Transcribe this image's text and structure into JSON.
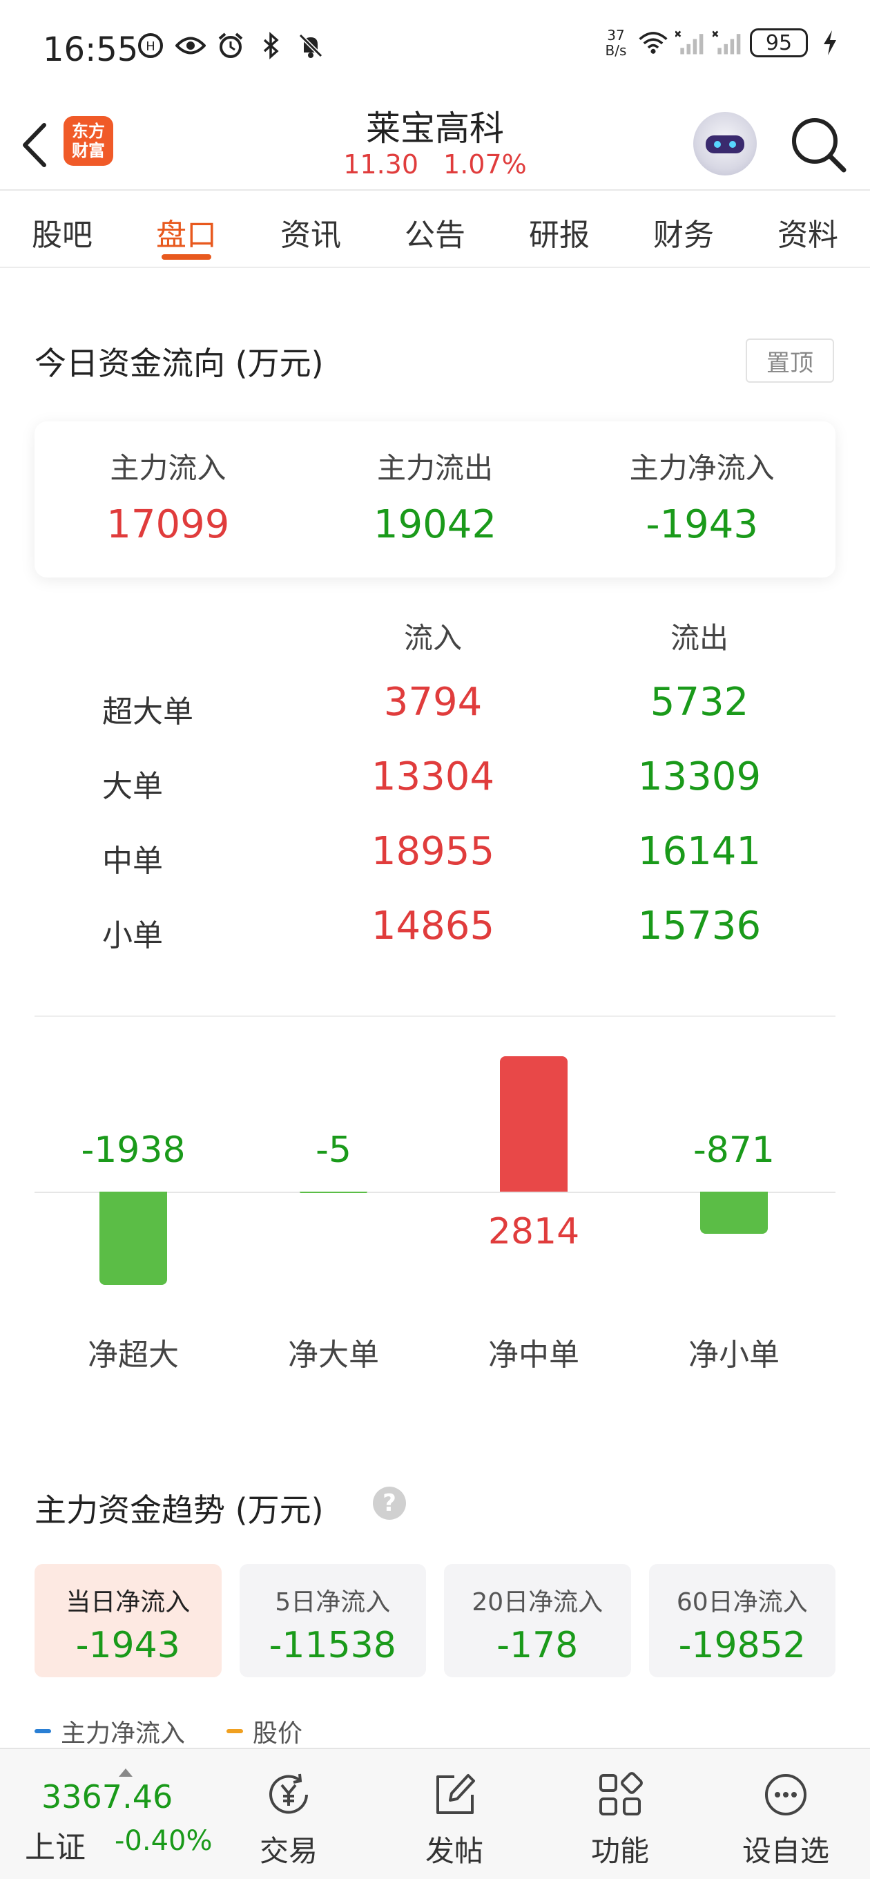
{
  "status_bar": {
    "time": "16:55",
    "net_speed_value": "37",
    "net_speed_unit": "B/s",
    "battery": "95"
  },
  "header": {
    "logo_line1": "东方",
    "logo_line2": "财富",
    "stock_name": "莱宝高科",
    "price": "11.30",
    "change_pct": "1.07%"
  },
  "tabs": [
    {
      "label": "股吧"
    },
    {
      "label": "盘口",
      "active": true
    },
    {
      "label": "资讯"
    },
    {
      "label": "公告"
    },
    {
      "label": "研报"
    },
    {
      "label": "财务"
    },
    {
      "label": "资料"
    }
  ],
  "fund_flow": {
    "title": "今日资金流向 (万元)",
    "pin_label": "置顶",
    "summary": [
      {
        "label": "主力流入",
        "value": "17099",
        "color": "#e03c3c"
      },
      {
        "label": "主力流出",
        "value": "19042",
        "color": "#1a9a1a"
      },
      {
        "label": "主力净流入",
        "value": "-1943",
        "color": "#1a9a1a"
      }
    ],
    "col_in": "流入",
    "col_out": "流出",
    "rows": [
      {
        "label": "超大单",
        "in": "3794",
        "out": "5732"
      },
      {
        "label": "大单",
        "in": "13304",
        "out": "13309"
      },
      {
        "label": "中单",
        "in": "18955",
        "out": "16141"
      },
      {
        "label": "小单",
        "in": "14865",
        "out": "15736"
      }
    ]
  },
  "chart_data": {
    "type": "bar",
    "categories": [
      "净超大",
      "净大单",
      "净中单",
      "净小单"
    ],
    "values": [
      -1938,
      -5,
      2814,
      -871
    ],
    "value_labels": [
      "-1938",
      "-5",
      "2814",
      "-871"
    ],
    "colors": {
      "positive": "#e84848",
      "negative": "#5bbd46"
    },
    "title": "",
    "xlabel": "",
    "ylabel": ""
  },
  "trend": {
    "title": "主力资金趋势 (万元)",
    "periods": [
      {
        "label": "当日净流入",
        "value": "-1943",
        "active": true
      },
      {
        "label": "5日净流入",
        "value": "-11538"
      },
      {
        "label": "20日净流入",
        "value": "-178"
      },
      {
        "label": "60日净流入",
        "value": "-19852"
      }
    ],
    "legend": [
      {
        "label": "主力净流入",
        "color": "#2a7fd4"
      },
      {
        "label": "股价",
        "color": "#f0a020"
      }
    ]
  },
  "bottom_bar": {
    "index_value": "3367.46",
    "index_name": "上证",
    "index_change": "-0.40%",
    "nav": [
      {
        "label": "交易",
        "icon": "trade-yen-icon"
      },
      {
        "label": "发帖",
        "icon": "compose-icon"
      },
      {
        "label": "功能",
        "icon": "grid-apps-icon"
      },
      {
        "label": "设自选",
        "icon": "more-dots-icon"
      }
    ]
  }
}
